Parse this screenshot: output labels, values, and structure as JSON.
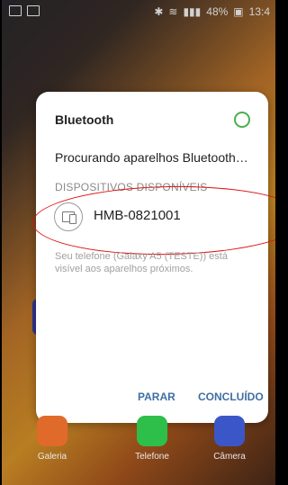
{
  "status_bar": {
    "time": "13:4",
    "battery": "48%"
  },
  "dialog": {
    "title": "Bluetooth",
    "scanning_text": "Procurando aparelhos Bluetooth…",
    "section_label": "DISPOSITIVOS DISPONÍVEIS",
    "device": {
      "name": "HMB-0821001",
      "icon": "devices-icon"
    },
    "visible_text": "Seu telefone (Galaxy A5 (TESTE)) está visível aos aparelhos próximos.",
    "buttons": {
      "stop": "PARAR",
      "done": "CONCLUÍDO"
    },
    "accent_color": "#3f6fa3",
    "toggle_color": "#4caf50",
    "annotation_color": "#d11111"
  },
  "dock": {
    "apps": [
      {
        "label": "Galeria",
        "icon": "gallery-icon"
      },
      {
        "label": "Telefone",
        "icon": "phone-icon"
      },
      {
        "label": "Câmera",
        "icon": "camera-icon"
      }
    ]
  }
}
